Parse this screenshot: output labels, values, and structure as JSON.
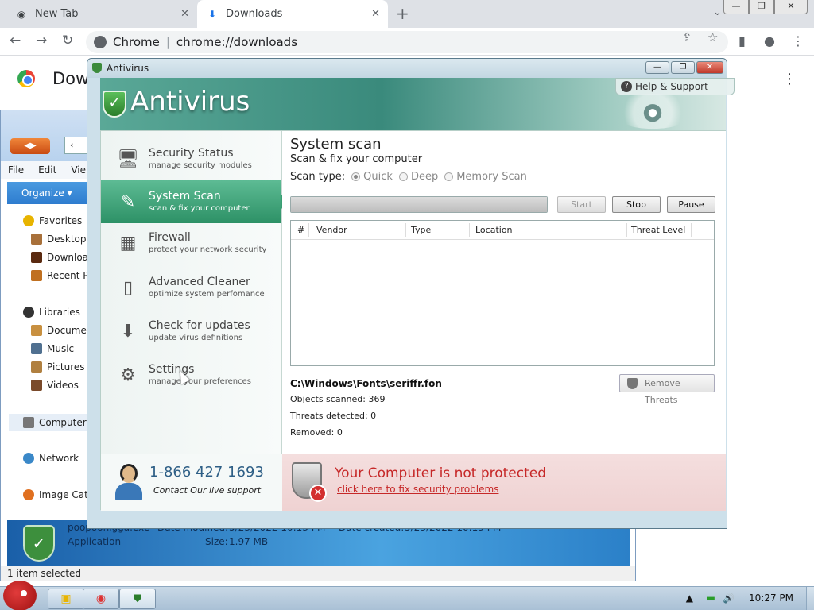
{
  "browser": {
    "tabs": [
      {
        "label": "New Tab"
      },
      {
        "label": "Downloads"
      }
    ],
    "omnibox": {
      "site": "Chrome",
      "separator": "|",
      "url": "chrome://downloads"
    },
    "page_title_visible": "Dow"
  },
  "explorer": {
    "menu": [
      "File",
      "Edit",
      "Vie"
    ],
    "organize": "Organize ▾",
    "tree": {
      "favorites": "Favorites",
      "desktop": "Desktop",
      "downloads": "Downloa",
      "recent": "Recent P",
      "libraries": "Libraries",
      "documents": "Documen",
      "music": "Music",
      "pictures": "Pictures",
      "videos": "Videos",
      "computer": "Computer",
      "network": "Network",
      "image_cat": "Image Cat"
    },
    "details": {
      "filename": "poopoonigga.exe",
      "date_modified_label": "Date modified:",
      "date_modified": "5/23/2022 10:13 PM",
      "date_created_label": "Date created:",
      "date_created": "5/23/2022 10:13 PM",
      "type": "Application",
      "size_label": "Size:",
      "size": "1.97 MB"
    },
    "status": "1 item selected"
  },
  "antivirus": {
    "window_title": "Antivirus",
    "logo_text": "Antivirus",
    "help": "Help & Support",
    "nav": [
      {
        "title": "Security Status",
        "sub": "manage security modules"
      },
      {
        "title": "System Scan",
        "sub": "scan & fix your computer"
      },
      {
        "title": "Firewall",
        "sub": "protect your network security"
      },
      {
        "title": "Advanced Cleaner",
        "sub": "optimize system perfomance"
      },
      {
        "title": "Check for updates",
        "sub": "update virus definitions"
      },
      {
        "title": "Settings",
        "sub": "manage your preferences"
      }
    ],
    "support": {
      "phone": "1-866 427 1693",
      "contact": "Contact Our live support"
    },
    "scan": {
      "title": "System scan",
      "subtitle": "Scan & fix your computer",
      "type_label": "Scan type:",
      "types": [
        "Quick",
        "Deep",
        "Memory Scan"
      ],
      "selected_type": "Quick",
      "progress_fraction": 1.0,
      "buttons": {
        "start": "Start",
        "stop": "Stop",
        "pause": "Pause"
      },
      "columns": [
        "#",
        "Vendor",
        "Type",
        "Location",
        "Threat Level"
      ],
      "current_file": "C:\\Windows\\Fonts\\seriffr.fon",
      "objects_scanned": "Objects scanned: 369",
      "threats_detected": "Threats detected: 0",
      "removed": "Removed: 0",
      "remove_button": "Remove Threats"
    },
    "warning": {
      "title": "Your Computer is not protected",
      "link": "click here to fix security problems"
    }
  },
  "taskbar": {
    "clock": "10:27 PM"
  },
  "colors": {
    "accent_green": "#2d9166",
    "warning_red": "#c62828",
    "support_blue": "#2e5f86"
  }
}
